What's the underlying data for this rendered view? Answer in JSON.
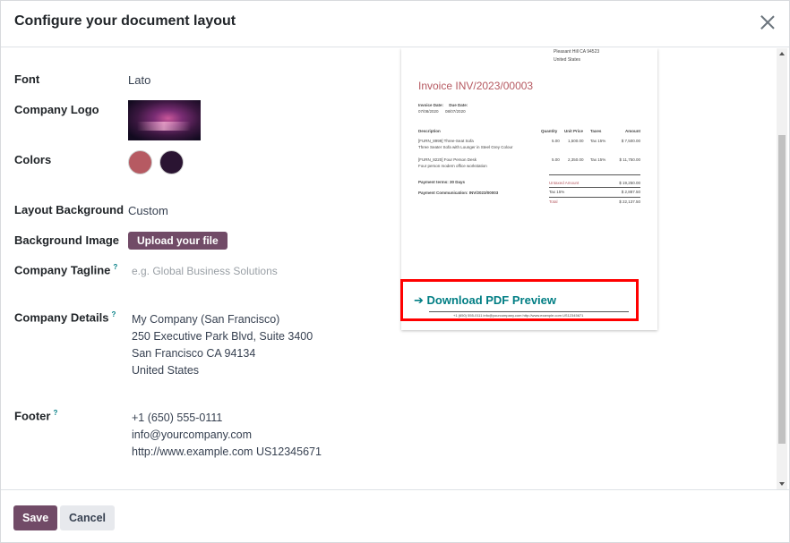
{
  "dialog": {
    "title": "Configure your document layout"
  },
  "form": {
    "font": {
      "label": "Font",
      "value": "Lato"
    },
    "logo": {
      "label": "Company Logo"
    },
    "colors": {
      "label": "Colors",
      "primary": "#b65a62",
      "secondary": "#2a1432"
    },
    "layout_background": {
      "label": "Layout Background",
      "value": "Custom"
    },
    "background_image": {
      "label": "Background Image",
      "button": "Upload your file"
    },
    "tagline": {
      "label": "Company Tagline",
      "help": "?",
      "placeholder": "e.g. Global Business Solutions"
    },
    "company_details": {
      "label": "Company Details",
      "help": "?",
      "lines": [
        "My Company (San Francisco)",
        "250 Executive Park Blvd, Suite 3400",
        "San Francisco CA 94134",
        "United States"
      ]
    },
    "footer": {
      "label": "Footer",
      "help": "?",
      "lines": [
        "+1 (650) 555-0111",
        "info@yourcompany.com",
        "http://www.example.com US12345671"
      ]
    }
  },
  "preview": {
    "address_lines": [
      "Pleasant Hill CA 94523",
      "United States"
    ],
    "invoice_title": "Invoice INV/2023/00003",
    "invoice_date_label": "Invoice Date:",
    "invoice_date": "07/08/2020",
    "due_date_label": "Due Date:",
    "due_date": "08/07/2020",
    "headers": [
      "Description",
      "Quantity",
      "Unit Price",
      "Taxes",
      "Amount"
    ],
    "rows": [
      {
        "desc": "[FURN_8999] Three-Seat Sofa",
        "sub": "Three Seater Sofa with Lounger in Steel Grey Colour",
        "qty": "5.00",
        "price": "1,500.00",
        "tax": "Tax 15%",
        "amount": "$ 7,500.00"
      },
      {
        "desc": "[FURN_8220] Four Person Desk",
        "sub": "Four person modern office workstation",
        "qty": "5.00",
        "price": "2,350.00",
        "tax": "Tax 15%",
        "amount": "$ 11,750.00"
      }
    ],
    "payment_terms": "Payment terms: 30 Days",
    "payment_comm": "Payment Communication: INV/2023/00003",
    "untaxed_label": "Untaxed Amount",
    "untaxed": "$ 19,250.00",
    "tax_label": "Tax 15%",
    "tax": "$ 2,887.50",
    "total_label": "Total",
    "total": "$ 22,137.50",
    "footer_text": "+1 (650) 555-0111 info@yourcompany.com http://www.example.com US12345671"
  },
  "download": {
    "label": "Download PDF Preview",
    "arrow": "➔"
  },
  "buttons": {
    "save": "Save",
    "cancel": "Cancel"
  }
}
